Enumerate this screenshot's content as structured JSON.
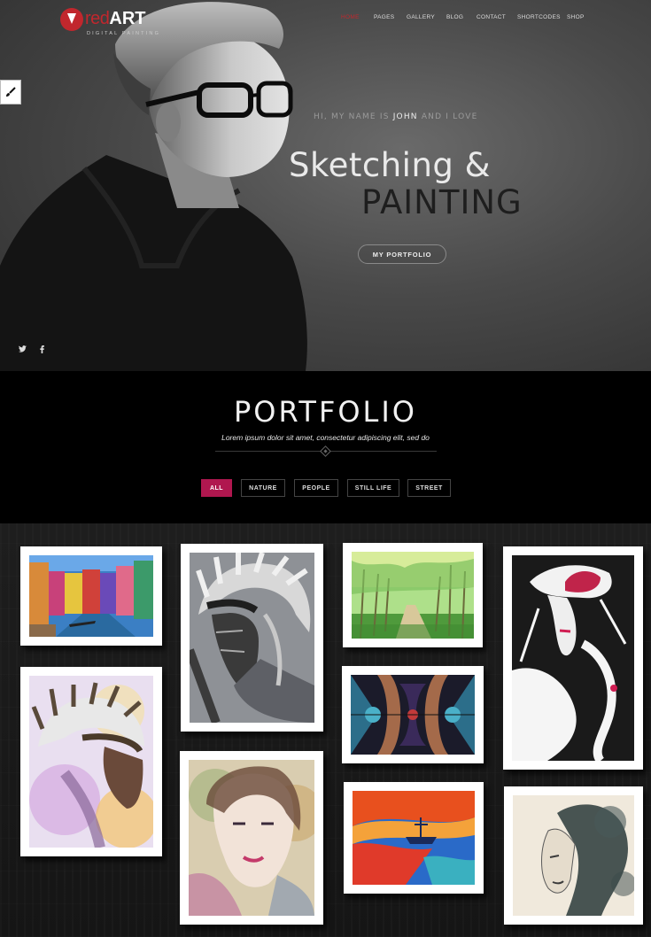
{
  "brand": {
    "prefix": "red",
    "main": "ART",
    "tagline": "DIGITAL PAINTING"
  },
  "nav": [
    {
      "label": "HOME",
      "active": true
    },
    {
      "label": "PAGES"
    },
    {
      "label": "GALLERY"
    },
    {
      "label": "BLOG"
    },
    {
      "label": "CONTACT"
    },
    {
      "label": "SHORTCODES"
    },
    {
      "label": "SHOP"
    }
  ],
  "hero": {
    "intro_before": "HI, MY NAME IS",
    "intro_name": "JOHN",
    "intro_after": "AND I LOVE",
    "line1": "Sketching &",
    "line2": "PAINTING",
    "cta": "MY PORTFOLIO"
  },
  "social": {
    "twitter": "twitter-icon",
    "facebook": "facebook-icon"
  },
  "portfolio": {
    "title": "PORTFOLIO",
    "subtitle": "Lorem ipsum dolor sit amet, consectetur adipiscing elit, sed do",
    "filters": [
      {
        "label": "ALL",
        "active": true
      },
      {
        "label": "NATURE"
      },
      {
        "label": "PEOPLE"
      },
      {
        "label": "STILL LIFE"
      },
      {
        "label": "STREET"
      }
    ]
  },
  "gallery": [
    {
      "name": "venice-canal-painting"
    },
    {
      "name": "native-chief-sketch"
    },
    {
      "name": "forest-path-painting"
    },
    {
      "name": "woman-hat-ink-painting"
    },
    {
      "name": "native-chief-watercolor"
    },
    {
      "name": "stained-glass-art"
    },
    {
      "name": "woman-face-watercolor"
    },
    {
      "name": "sunset-boat-painting"
    },
    {
      "name": "woman-ink-portrait"
    }
  ],
  "colors": {
    "accent": "#b0174f",
    "logo_red": "#c1272d"
  }
}
